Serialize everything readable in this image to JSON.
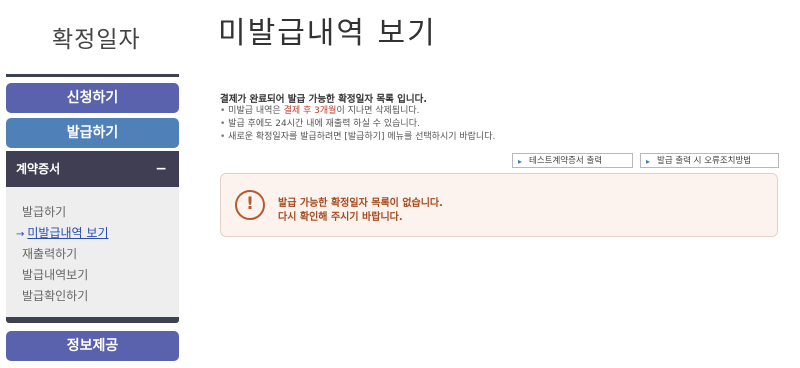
{
  "sidebar": {
    "logo": "확정일자",
    "nav": {
      "apply": "신청하기",
      "issue": "발급하기",
      "info": "정보제공"
    },
    "section": {
      "title": "계약증서",
      "toggle": "−"
    },
    "sub_items": [
      {
        "label": "발급하기"
      },
      {
        "label": "미발급내역 보기",
        "marker": "→"
      },
      {
        "label": "재출력하기"
      },
      {
        "label": "발급내역보기"
      },
      {
        "label": "발급확인하기"
      }
    ]
  },
  "main": {
    "title": "미발급내역 보기",
    "intro_title": "결제가 완료되어 발급 가능한 확정일자 목록 입니다.",
    "notes": {
      "n1_pre": "미발급 내역은 ",
      "n1_hl": "결제 후 3개월",
      "n1_post": "이 지나면 삭제됩니다.",
      "n2": "발급 후에도 24시간 내에 재출력 하실 수 있습니다.",
      "n3": "새로운 확정일자를 발급하려면 [발급하기] 메뉴를 선택하시기 바랍니다."
    },
    "buttons": {
      "test_print": "테스트계약증서 출력",
      "error_help": "발급 출력 시 오류조치방법",
      "chevron": "▸"
    },
    "alert": {
      "icon": "!",
      "line1": "발급 가능한 확정일자 목록이 없습니다.",
      "line2": "다시 확인해 주시기 바랍니다."
    }
  }
}
